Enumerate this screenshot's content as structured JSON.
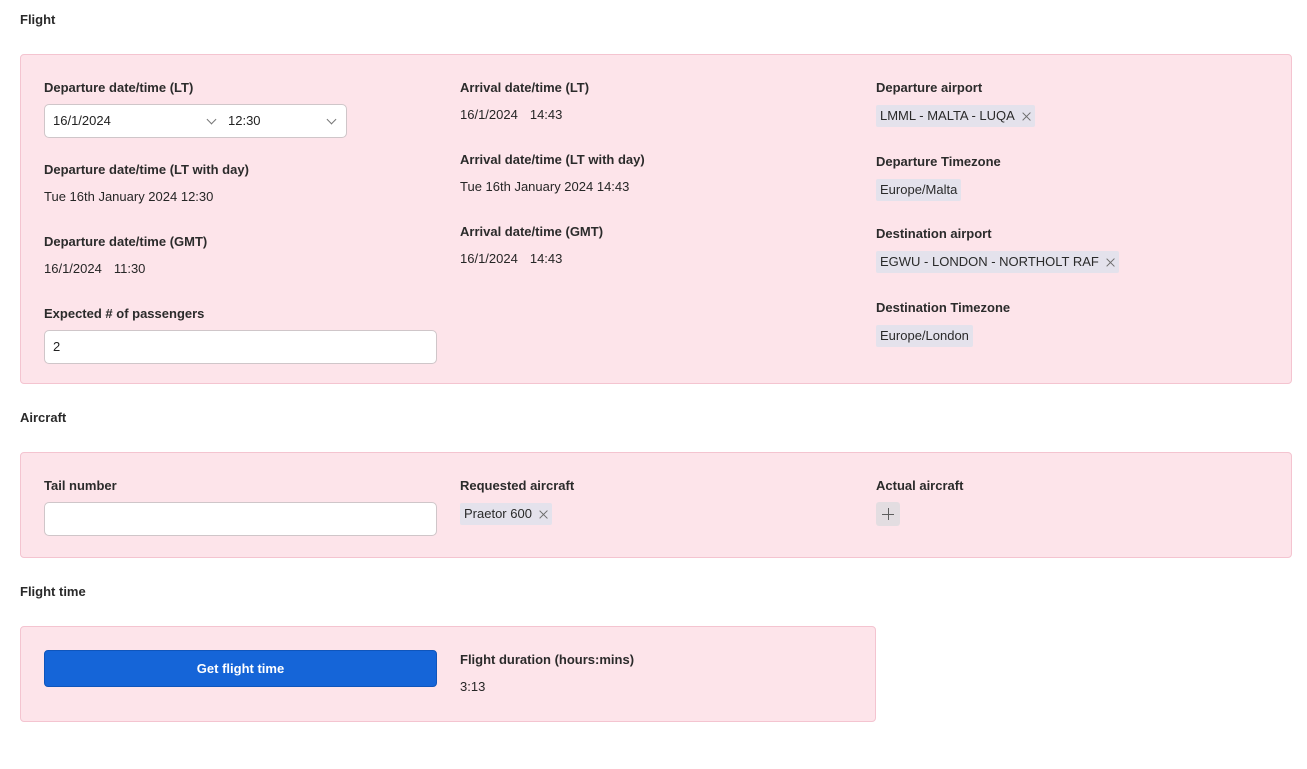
{
  "flight": {
    "section_title": "Flight",
    "departure_lt": {
      "label": "Departure date/time (LT)",
      "date": "16/1/2024",
      "time": "12:30"
    },
    "departure_lt_day": {
      "label": "Departure date/time (LT with day)",
      "value": "Tue 16th January 2024 12:30"
    },
    "departure_gmt": {
      "label": "Departure date/time (GMT)",
      "date": "16/1/2024",
      "time": "11:30"
    },
    "passengers": {
      "label": "Expected # of passengers",
      "value": "2"
    },
    "arrival_lt": {
      "label": "Arrival date/time (LT)",
      "date": "16/1/2024",
      "time": "14:43"
    },
    "arrival_lt_day": {
      "label": "Arrival date/time (LT with day)",
      "value": "Tue 16th January 2024 14:43"
    },
    "arrival_gmt": {
      "label": "Arrival date/time (GMT)",
      "date": "16/1/2024",
      "time": "14:43"
    },
    "departure_airport": {
      "label": "Departure airport",
      "value": "LMML - MALTA - LUQA"
    },
    "departure_timezone": {
      "label": "Departure Timezone",
      "value": "Europe/Malta"
    },
    "destination_airport": {
      "label": "Destination airport",
      "value": "EGWU - LONDON - NORTHOLT RAF"
    },
    "destination_timezone": {
      "label": "Destination Timezone",
      "value": "Europe/London"
    }
  },
  "aircraft": {
    "section_title": "Aircraft",
    "tail_number": {
      "label": "Tail number",
      "value": ""
    },
    "requested_aircraft": {
      "label": "Requested aircraft",
      "value": "Praetor 600"
    },
    "actual_aircraft": {
      "label": "Actual aircraft"
    }
  },
  "flight_time": {
    "section_title": "Flight time",
    "button_label": "Get flight time",
    "duration": {
      "label": "Flight duration (hours:mins)",
      "value": "3:13"
    }
  },
  "colors": {
    "panel_bg": "#fde4ea",
    "panel_border": "#f4c4d0",
    "chip_bg": "#e4e2ec",
    "primary": "#1565d8"
  }
}
